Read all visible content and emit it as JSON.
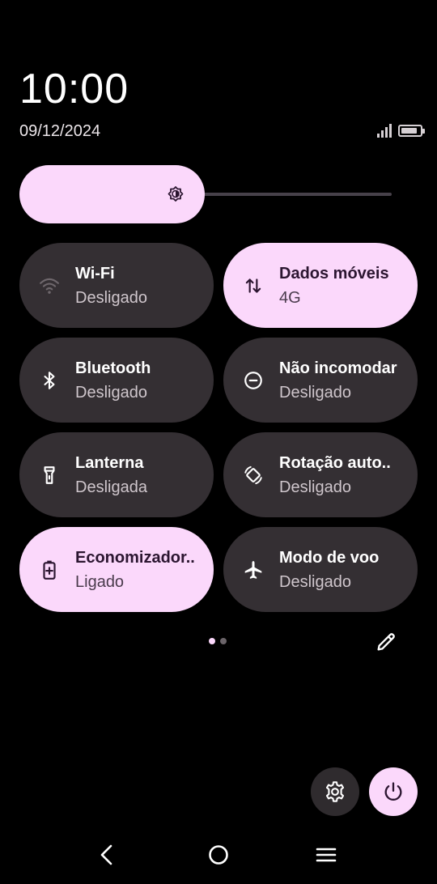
{
  "header": {
    "clock": "10:00",
    "date": "09/12/2024",
    "signal_icon": "signal-icon",
    "battery_icon": "battery-icon",
    "battery_level": 0.85
  },
  "brightness": {
    "level": 0.49,
    "icon": "brightness-icon"
  },
  "tiles": [
    {
      "title": "Wi-Fi",
      "subtitle": "Desligado",
      "icon": "wifi-icon",
      "active": false
    },
    {
      "title": "Dados móveis",
      "subtitle": "4G",
      "icon": "mobile-data-icon",
      "active": true
    },
    {
      "title": "Bluetooth",
      "subtitle": "Desligado",
      "icon": "bluetooth-icon",
      "active": false
    },
    {
      "title": "Não incomodar",
      "subtitle": "Desligado",
      "icon": "do-not-disturb-icon",
      "active": false
    },
    {
      "title": "Lanterna",
      "subtitle": "Desligada",
      "icon": "flashlight-icon",
      "active": false
    },
    {
      "title": "Rotação auto..",
      "subtitle": "Desligado",
      "icon": "auto-rotate-icon",
      "active": false
    },
    {
      "title": "Economizador..",
      "subtitle": "Ligado",
      "icon": "battery-saver-icon",
      "active": true
    },
    {
      "title": "Modo de voo",
      "subtitle": "Desligado",
      "icon": "airplane-icon",
      "active": false
    }
  ],
  "pager": {
    "pages": 2,
    "current": 1
  },
  "colors": {
    "accent": "#fbd8fb",
    "tile_off": "#342f33",
    "background": "#000000"
  },
  "actions": {
    "edit_icon": "pencil-icon",
    "settings_icon": "gear-icon",
    "power_icon": "power-icon"
  },
  "navbar": {
    "back_icon": "back-icon",
    "home_icon": "home-icon",
    "recents_icon": "menu-icon"
  }
}
